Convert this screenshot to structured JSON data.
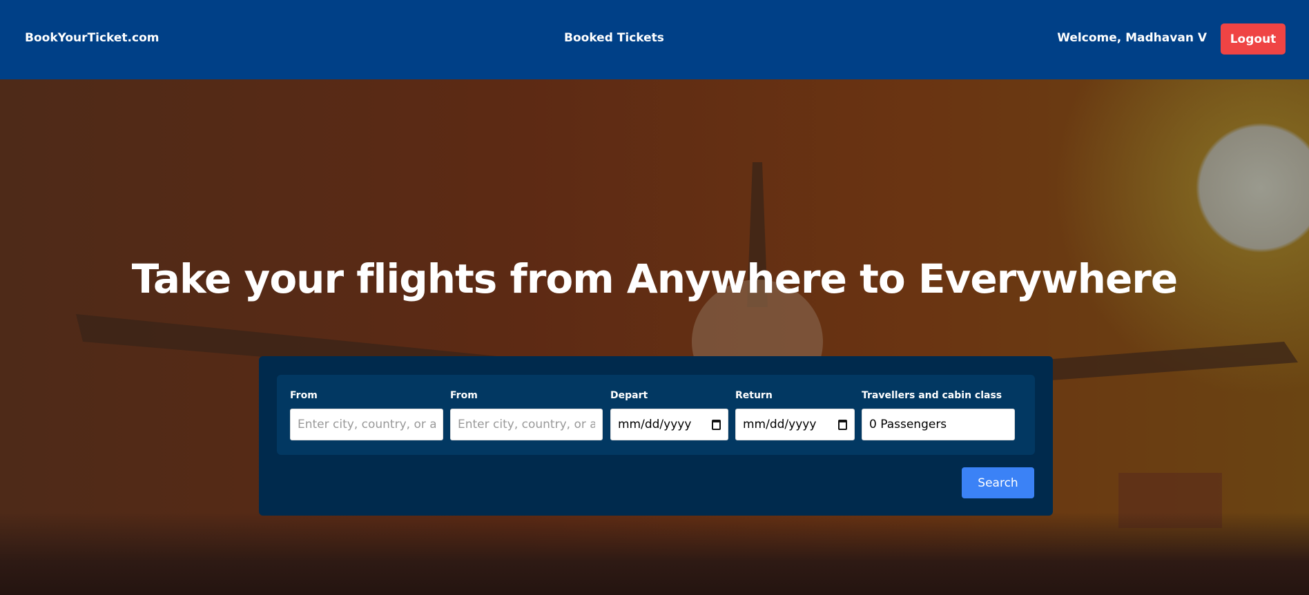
{
  "nav": {
    "logo": "BookYourTicket.com",
    "booked_tickets": "Booked Tickets",
    "welcome": "Welcome, Madhavan V",
    "logout": "Logout"
  },
  "hero": {
    "title": "Take your flights from Anywhere to Everywhere"
  },
  "form": {
    "from1": {
      "label": "From",
      "placeholder": "Enter city, country, or airport"
    },
    "from2": {
      "label": "From",
      "placeholder": "Enter city, country, or airport"
    },
    "depart": {
      "label": "Depart",
      "value": "mm/dd/yyyy"
    },
    "return": {
      "label": "Return",
      "value": "mm/dd/yyyy"
    },
    "travellers": {
      "label": "Travellers and cabin class",
      "value": "0 Passengers"
    },
    "search": "Search"
  },
  "colors": {
    "nav": "#004087",
    "logout": "#ef4444",
    "search": "#3b82f6",
    "card": "#002a4d"
  }
}
